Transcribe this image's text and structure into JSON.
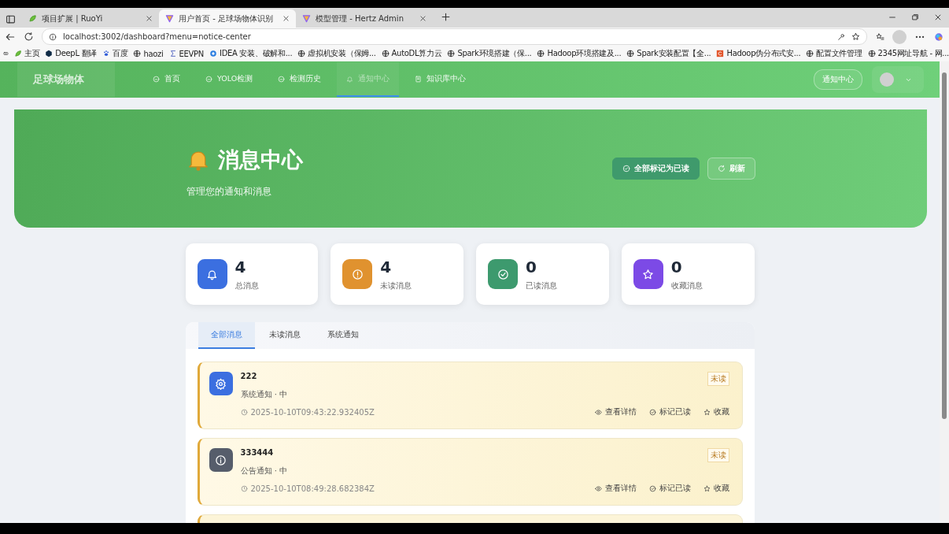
{
  "browser": {
    "tabs": [
      {
        "title": "项目扩展 | RuoYi",
        "kind": "leaf",
        "selected": false
      },
      {
        "title": "用户首页 - 足球场物体识别",
        "kind": "vee",
        "selected": true
      },
      {
        "title": "模型管理 - Hertz Admin",
        "kind": "vee",
        "selected": false
      }
    ],
    "url": "localhost:3002/dashboard?menu=notice-center",
    "bookmarks": [
      {
        "label": "主页",
        "kind": "leaf"
      },
      {
        "label": "DeepL 翻译",
        "kind": "hex"
      },
      {
        "label": "百度",
        "kind": "paw"
      },
      {
        "label": "haozi",
        "kind": "globe"
      },
      {
        "label": "EEVPN",
        "kind": "sigma"
      },
      {
        "label": "IDEA 安装、破解和...",
        "kind": "disc"
      },
      {
        "label": "虚拟机安装（保姆...",
        "kind": "globe"
      },
      {
        "label": "AutoDL算力云",
        "kind": "globe"
      },
      {
        "label": "Spark环境搭建（保...",
        "kind": "globe"
      },
      {
        "label": "Hadoop环境搭建及...",
        "kind": "globe"
      },
      {
        "label": "Spark安装配置【全...",
        "kind": "globe"
      },
      {
        "label": "Hadoop伪分布式安...",
        "kind": "c"
      },
      {
        "label": "配置文件管理",
        "kind": "globe"
      },
      {
        "label": "2345网址导航 - 网...",
        "kind": "globe"
      }
    ]
  },
  "nav": {
    "brand": "足球场物体",
    "items": [
      {
        "label": "首页",
        "selected": false
      },
      {
        "label": "YOLO检测",
        "selected": false
      },
      {
        "label": "检测历史",
        "selected": false
      },
      {
        "label": "通知中心",
        "selected": true
      },
      {
        "label": "知识库中心",
        "selected": false,
        "kind": "book"
      }
    ],
    "notice_button": "通知中心"
  },
  "hero": {
    "title": "消息中心",
    "subtitle": "管理您的通知和消息",
    "buttons": [
      {
        "label": "全部标记为已读",
        "kind": "check"
      },
      {
        "label": "刷新",
        "kind": "refresh"
      }
    ]
  },
  "stats": [
    {
      "value": "4",
      "label": "总消息",
      "kind": "bell",
      "color": "#3b6fe0"
    },
    {
      "value": "4",
      "label": "未读消息",
      "kind": "alert",
      "color": "#e0922f"
    },
    {
      "value": "0",
      "label": "已读消息",
      "kind": "check",
      "color": "#3d9a6e"
    },
    {
      "value": "0",
      "label": "收藏消息",
      "kind": "star",
      "color": "#7c4ae6"
    }
  ],
  "tabs": [
    {
      "label": "全部消息",
      "selected": true
    },
    {
      "label": "未读消息",
      "selected": false
    },
    {
      "label": "系统通知",
      "selected": false
    }
  ],
  "messages": [
    {
      "title": "222",
      "meta": "系统通知 · 中",
      "time": "2025-10-10T09:43:22.932405Z",
      "badge": "未读",
      "kind": "gear",
      "color": "#3b6fe0",
      "actions": [
        "查看详情",
        "标记已读",
        "收藏"
      ]
    },
    {
      "title": "333444",
      "meta": "公告通知 · 中",
      "time": "2025-10-10T08:49:28.682384Z",
      "badge": "未读",
      "kind": "info",
      "color": "#565d6b",
      "actions": [
        "查看详情",
        "标记已读",
        "收藏"
      ]
    }
  ]
}
